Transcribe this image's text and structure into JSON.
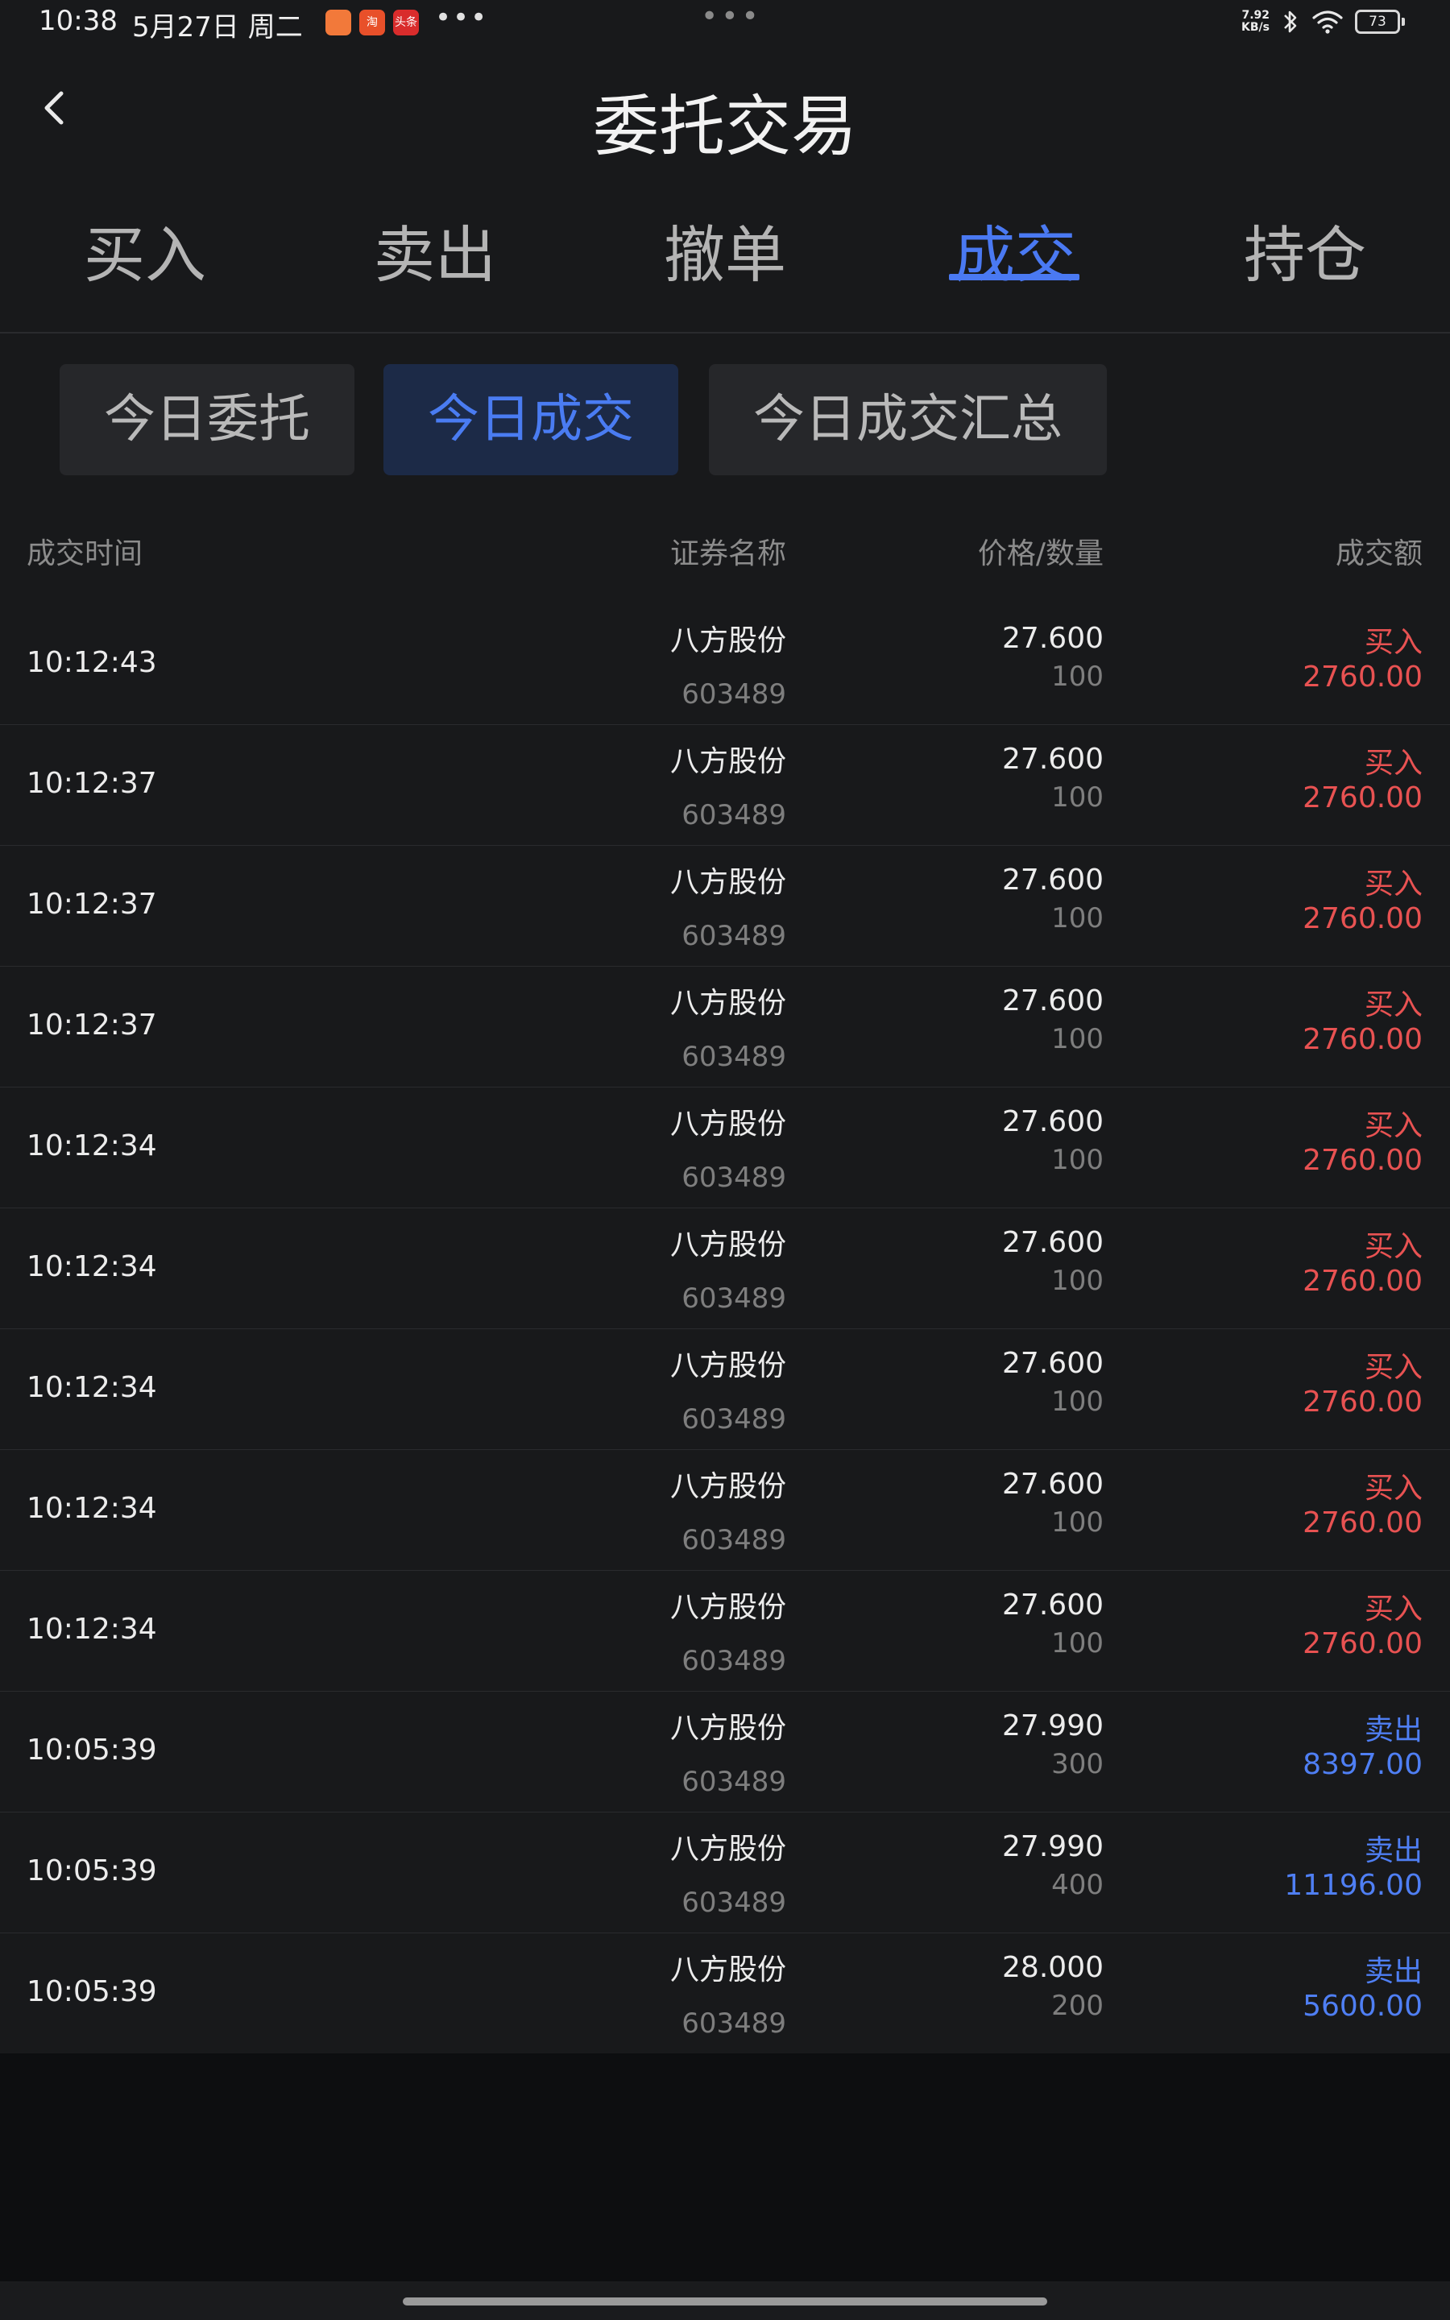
{
  "status_bar": {
    "time": "10:38",
    "date": "5月27日 周二",
    "apps": [
      {
        "name": "taobao-app-icon",
        "label": "",
        "color": "#f2793a"
      },
      {
        "name": "taobao-tao-app-icon",
        "label": "淘",
        "color": "#e8502a"
      },
      {
        "name": "toutiao-app-icon",
        "label": "头条",
        "color": "#d92c2c"
      }
    ],
    "more": "•••",
    "center_dots": "•••",
    "net_speed_value": "7.92",
    "net_speed_unit": "KB/s",
    "battery": "73"
  },
  "header": {
    "title": "委托交易",
    "tabs": [
      {
        "label": "买入",
        "active": false
      },
      {
        "label": "卖出",
        "active": false
      },
      {
        "label": "撤单",
        "active": false
      },
      {
        "label": "成交",
        "active": true
      },
      {
        "label": "持仓",
        "active": false
      }
    ]
  },
  "subnav": {
    "chips": [
      {
        "label": "今日委托",
        "active": false
      },
      {
        "label": "今日成交",
        "active": true
      },
      {
        "label": "今日成交汇总",
        "active": false
      }
    ]
  },
  "table": {
    "headers": {
      "time": "成交时间",
      "name": "证券名称",
      "price_qty": "价格/数量",
      "amount": "成交额"
    },
    "rows": [
      {
        "time": "10:12:43",
        "name": "八方股份",
        "code": "603489",
        "price": "27.600",
        "qty": "100",
        "side": "买入",
        "amount": "2760.00",
        "type": "buy"
      },
      {
        "time": "10:12:37",
        "name": "八方股份",
        "code": "603489",
        "price": "27.600",
        "qty": "100",
        "side": "买入",
        "amount": "2760.00",
        "type": "buy"
      },
      {
        "time": "10:12:37",
        "name": "八方股份",
        "code": "603489",
        "price": "27.600",
        "qty": "100",
        "side": "买入",
        "amount": "2760.00",
        "type": "buy"
      },
      {
        "time": "10:12:37",
        "name": "八方股份",
        "code": "603489",
        "price": "27.600",
        "qty": "100",
        "side": "买入",
        "amount": "2760.00",
        "type": "buy"
      },
      {
        "time": "10:12:34",
        "name": "八方股份",
        "code": "603489",
        "price": "27.600",
        "qty": "100",
        "side": "买入",
        "amount": "2760.00",
        "type": "buy"
      },
      {
        "time": "10:12:34",
        "name": "八方股份",
        "code": "603489",
        "price": "27.600",
        "qty": "100",
        "side": "买入",
        "amount": "2760.00",
        "type": "buy"
      },
      {
        "time": "10:12:34",
        "name": "八方股份",
        "code": "603489",
        "price": "27.600",
        "qty": "100",
        "side": "买入",
        "amount": "2760.00",
        "type": "buy"
      },
      {
        "time": "10:12:34",
        "name": "八方股份",
        "code": "603489",
        "price": "27.600",
        "qty": "100",
        "side": "买入",
        "amount": "2760.00",
        "type": "buy"
      },
      {
        "time": "10:12:34",
        "name": "八方股份",
        "code": "603489",
        "price": "27.600",
        "qty": "100",
        "side": "买入",
        "amount": "2760.00",
        "type": "buy"
      },
      {
        "time": "10:05:39",
        "name": "八方股份",
        "code": "603489",
        "price": "27.990",
        "qty": "300",
        "side": "卖出",
        "amount": "8397.00",
        "type": "sell"
      },
      {
        "time": "10:05:39",
        "name": "八方股份",
        "code": "603489",
        "price": "27.990",
        "qty": "400",
        "side": "卖出",
        "amount": "11196.00",
        "type": "sell"
      },
      {
        "time": "10:05:39",
        "name": "八方股份",
        "code": "603489",
        "price": "28.000",
        "qty": "200",
        "side": "卖出",
        "amount": "5600.00",
        "type": "sell"
      }
    ]
  },
  "colors": {
    "accent": "#4a79f2",
    "buy": "#e85252",
    "sell": "#4f7ff4",
    "background": "#18191b"
  }
}
